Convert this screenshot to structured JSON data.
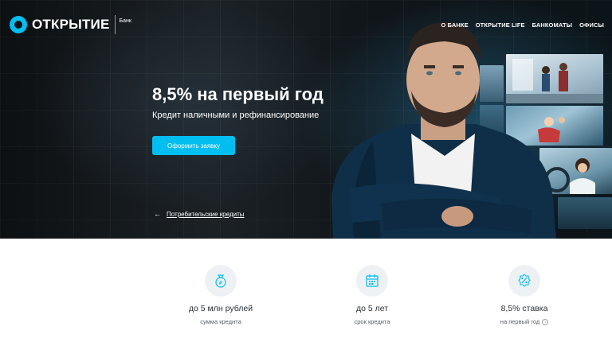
{
  "header": {
    "logo_text": "ОТКРЫТИЕ",
    "logo_sub": "Банк",
    "nav": [
      "О БАНКЕ",
      "ОТКРЫТИЕ LIFE",
      "БАНКОМАТЫ",
      "ОФИСЫ"
    ]
  },
  "hero": {
    "title": "8,5% на первый год",
    "subtitle": "Кредит наличными и рефинансирование",
    "cta_label": "Оформить заявку",
    "back_link_label": "Потребительские кредиты"
  },
  "features": [
    {
      "icon": "money-bag-icon",
      "title": "до 5 млн рублей",
      "subtitle": "сумма кредита"
    },
    {
      "icon": "calendar-icon",
      "title": "до 5 лет",
      "subtitle": "срок кредита"
    },
    {
      "icon": "percent-icon",
      "title": "8,5% ставка",
      "subtitle": "на первый год"
    }
  ],
  "colors": {
    "accent": "#00bef0",
    "hero_bg": "#141a1e",
    "text_dark": "#2c3338"
  }
}
